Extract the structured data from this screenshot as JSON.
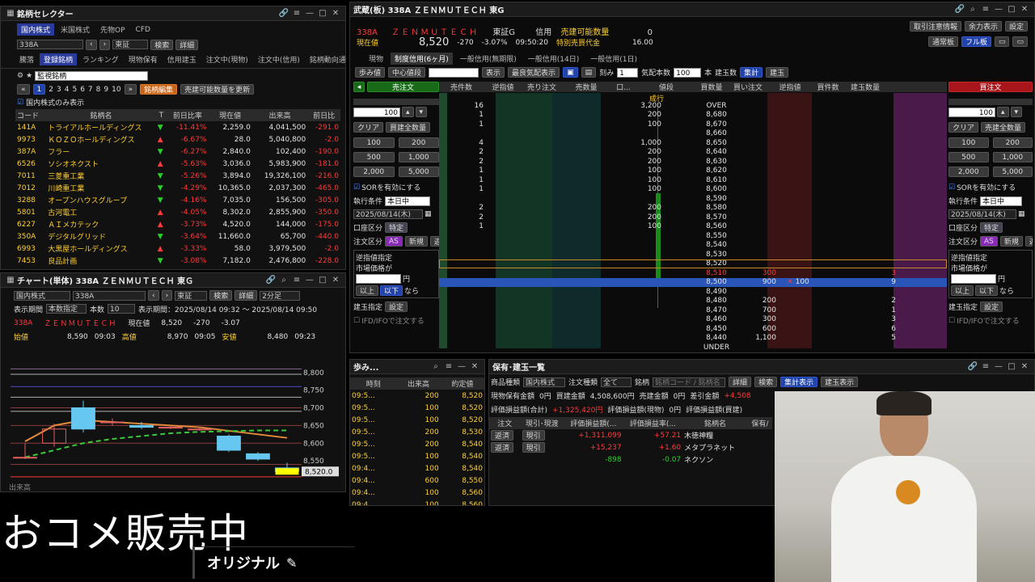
{
  "selector": {
    "title": "銘柄セレクター",
    "tabs1": [
      "国内株式",
      "米国株式",
      "先物OP",
      "CFD"
    ],
    "code": "338A",
    "market": "東証",
    "search": "検索",
    "detail": "詳細",
    "tabs2": [
      "騰落",
      "登録銘柄",
      "ランキング",
      "現物保有",
      "信用建玉",
      "注文中(現物)",
      "注文中(信用)",
      "銘柄動向通知"
    ],
    "list_name": "監視銘柄",
    "pages": [
      "1",
      "2",
      "3",
      "4",
      "5",
      "6",
      "7",
      "8",
      "9",
      "10"
    ],
    "edit_btn": "銘柄編集",
    "refresh_btn": "売建可能数量を更新",
    "show_domestic": "国内株式のみ表示",
    "cols": [
      "コード",
      "銘柄名",
      "T",
      "前日比率",
      "現在値",
      "出来高",
      "前日比"
    ],
    "rows": [
      {
        "code": "141A",
        "name": "トライアルホールディングス",
        "t": "▼",
        "rate": "-11.41%",
        "price": "2,259.0",
        "vol": "4,041,500",
        "diff": "-291.0"
      },
      {
        "code": "9973",
        "name": "ＫＯＺＯホールディングス",
        "t": "▲",
        "rate": "-6.67%",
        "price": "28.0",
        "vol": "5,040,800",
        "diff": "-2.0"
      },
      {
        "code": "387A",
        "name": "フラー",
        "t": "▼",
        "rate": "-6.27%",
        "price": "2,840.0",
        "vol": "102,400",
        "diff": "-190.0"
      },
      {
        "code": "6526",
        "name": "ソシオネクスト",
        "t": "▲",
        "rate": "-5.63%",
        "price": "3,036.0",
        "vol": "5,983,900",
        "diff": "-181.0"
      },
      {
        "code": "7011",
        "name": "三菱重工業",
        "t": "▼",
        "rate": "-5.26%",
        "price": "3,894.0",
        "vol": "19,326,100",
        "diff": "-216.0"
      },
      {
        "code": "7012",
        "name": "川崎重工業",
        "t": "▼",
        "rate": "-4.29%",
        "price": "10,365.0",
        "vol": "2,037,300",
        "diff": "-465.0"
      },
      {
        "code": "3288",
        "name": "オープンハウスグループ",
        "t": "▼",
        "rate": "-4.16%",
        "price": "7,035.0",
        "vol": "156,500",
        "diff": "-305.0"
      },
      {
        "code": "5801",
        "name": "古河電工",
        "t": "▲",
        "rate": "-4.05%",
        "price": "8,302.0",
        "vol": "2,855,900",
        "diff": "-350.0"
      },
      {
        "code": "6227",
        "name": "ＡＩメカテック",
        "t": "▲",
        "rate": "-3.73%",
        "price": "4,520.0",
        "vol": "144,000",
        "diff": "-175.0"
      },
      {
        "code": "350A",
        "name": "デジタルグリッド",
        "t": "▼",
        "rate": "-3.64%",
        "price": "11,660.0",
        "vol": "65,700",
        "diff": "-440.0"
      },
      {
        "code": "6993",
        "name": "大黒屋ホールディングス",
        "t": "▲",
        "rate": "-3.33%",
        "price": "58.0",
        "vol": "3,979,500",
        "diff": "-2.0"
      },
      {
        "code": "7453",
        "name": "良品計画",
        "t": "▼",
        "rate": "-3.08%",
        "price": "7,182.0",
        "vol": "2,476,800",
        "diff": "-228.0"
      }
    ]
  },
  "chart": {
    "title": "チャート(単体) 338A ＺＥＮＭＵＴＥＣＨ 東Ｇ",
    "market_sel": "国内株式",
    "code": "338A",
    "exch": "東証",
    "search": "検索",
    "detail": "詳細",
    "interval": "2分足",
    "period_label": "表示期間",
    "period_sel": "本数指定",
    "bars_label": "本数",
    "bars": "10",
    "range_label": "表示期間：2025/08/14 09:32 ～ 2025/08/14 09:50",
    "code_disp": "338A",
    "name_disp": "ＺＥＮＭＵＴＥＣＨ",
    "cur_label": "現在値",
    "cur": "8,520",
    "chg": "-270",
    "chg_pct": "-3.07",
    "open_label": "始値",
    "open": "8,590",
    "open_t": "09:03",
    "high_label": "高値",
    "high": "8,970",
    "high_t": "09:05",
    "low_label": "安値",
    "low": "8,480",
    "low_t": "09:23",
    "yticks": [
      "8,800",
      "8,750",
      "8,700",
      "8,650",
      "8,600",
      "8,550"
    ],
    "price_tag": "8,520.0",
    "bottom_label": "出来高"
  },
  "chart_data": {
    "type": "candlestick",
    "ylim": [
      8500,
      8820
    ],
    "candles": [
      {
        "o": 8560,
        "c": 8560,
        "h": 8600,
        "l": 8555
      },
      {
        "o": 8600,
        "c": 8640,
        "h": 8655,
        "l": 8590
      },
      {
        "o": 8700,
        "c": 8640,
        "h": 8720,
        "l": 8630
      },
      {
        "o": 8660,
        "c": 8660,
        "h": 8670,
        "l": 8650
      },
      {
        "o": 8650,
        "c": 8645,
        "h": 8660,
        "l": 8640
      },
      {
        "o": 8645,
        "c": 8645,
        "h": 8650,
        "l": 8640
      },
      {
        "o": 8640,
        "c": 8640,
        "h": 8645,
        "l": 8635
      },
      {
        "o": 8620,
        "c": 8580,
        "h": 8625,
        "l": 8575
      },
      {
        "o": 8570,
        "c": 8555,
        "h": 8575,
        "l": 8550
      },
      {
        "o": 8530,
        "c": 8520,
        "h": 8545,
        "l": 8520
      }
    ],
    "ma_short": [
      8605,
      8650,
      8665,
      8660,
      8655,
      8650,
      8645,
      8635,
      8625,
      8615
    ],
    "ma_long": [
      8560,
      8580,
      8600,
      8612,
      8620,
      8628,
      8632,
      8634,
      8636,
      8636
    ]
  },
  "board": {
    "title": "武蔵(板) 338A ＺＥＮＭＵＴＥＣＨ 東G",
    "top_btns": [
      "取引注意情報",
      "余力表示",
      "設定"
    ],
    "mode_btns": [
      "通常板",
      "フル板"
    ],
    "code": "338A",
    "name": "ＺＥＮＭＵＴＥＣＨ",
    "market": "東証G",
    "margin": "信用",
    "sellable_label": "売建可能数量",
    "sellable": "0",
    "cur_label": "現在値",
    "cur": "8,520",
    "chg": "-270",
    "chg_pct": "-3.07%",
    "time": "09:50:20",
    "special_label": "特別売買代金",
    "special": "16.00",
    "tabs": [
      "現物",
      "制度信用(6ヶ月)",
      "一般信用(無期限)",
      "一般信用(14日)",
      "一般信用(1日)"
    ],
    "toolbar": {
      "walk": "歩み値",
      "center": "中心値段",
      "display": "表示",
      "recent": "最良気配表示",
      "ticks": "刻み",
      "ticks_val": "1",
      "qty": "気配本数",
      "qty_val": "100",
      "unit": "本",
      "pos": "建玉数",
      "agg": "集計",
      "pos2": "建玉"
    },
    "sell_order": "売注文",
    "buy_order": "買注文",
    "cols": [
      "売件数",
      "逆指値",
      "売り注文",
      "売数量",
      "口...",
      "値段",
      "買数量",
      "買い注文",
      "逆指値",
      "買件数",
      "建玉数量"
    ],
    "rows": [
      {
        "sc": "16",
        "sq": "3,200",
        "p": "OVER",
        "bq": "",
        "bc": ""
      },
      {
        "sc": "1",
        "sq": "200",
        "p": "8,680",
        "bq": "",
        "bc": ""
      },
      {
        "sc": "1",
        "sq": "100",
        "p": "8,670",
        "bq": "",
        "bc": ""
      },
      {
        "sc": "",
        "sq": "",
        "p": "8,660",
        "bq": "",
        "bc": ""
      },
      {
        "sc": "4",
        "sq": "1,000",
        "p": "8,650",
        "bq": "",
        "bc": ""
      },
      {
        "sc": "2",
        "sq": "200",
        "p": "8,640",
        "bq": "",
        "bc": ""
      },
      {
        "sc": "2",
        "sq": "200",
        "p": "8,630",
        "bq": "",
        "bc": ""
      },
      {
        "sc": "1",
        "sq": "100",
        "p": "8,620",
        "bq": "",
        "bc": ""
      },
      {
        "sc": "1",
        "sq": "100",
        "p": "8,610",
        "bq": "",
        "bc": ""
      },
      {
        "sc": "1",
        "sq": "100",
        "p": "8,600",
        "bq": "",
        "bc": ""
      },
      {
        "sc": "",
        "sq": "",
        "p": "8,590",
        "bq": "",
        "bc": ""
      },
      {
        "sc": "2",
        "sq": "200",
        "p": "8,580",
        "bq": "",
        "bc": ""
      },
      {
        "sc": "2",
        "sq": "200",
        "p": "8,570",
        "bq": "",
        "bc": ""
      },
      {
        "sc": "1",
        "sq": "100",
        "p": "8,560",
        "bq": "",
        "bc": ""
      },
      {
        "sc": "",
        "sq": "",
        "p": "8,550",
        "bq": "",
        "bc": ""
      },
      {
        "sc": "",
        "sq": "",
        "p": "8,540",
        "bq": "",
        "bc": ""
      },
      {
        "sc": "",
        "sq": "",
        "p": "8,530",
        "bq": "",
        "bc": ""
      },
      {
        "sc": "",
        "sq": "",
        "p": "8,520",
        "bq": "",
        "bc": ""
      },
      {
        "sc": "",
        "sq": "",
        "p": "8,510",
        "bq": "300",
        "bc": "3"
      },
      {
        "sc": "",
        "sq": "",
        "p": "8,500",
        "bq": "900",
        "bc": "9",
        "mine": "100"
      },
      {
        "sc": "",
        "sq": "",
        "p": "8,490",
        "bq": "",
        "bc": ""
      },
      {
        "sc": "",
        "sq": "",
        "p": "8,480",
        "bq": "200",
        "bc": "2"
      },
      {
        "sc": "",
        "sq": "",
        "p": "8,470",
        "bq": "700",
        "bc": "1"
      },
      {
        "sc": "",
        "sq": "",
        "p": "8,460",
        "bq": "300",
        "bc": "3"
      },
      {
        "sc": "",
        "sq": "",
        "p": "8,450",
        "bq": "600",
        "bc": "6"
      },
      {
        "sc": "",
        "sq": "",
        "p": "8,440",
        "bq": "1,100",
        "bc": "5"
      },
      {
        "sc": "",
        "sq": "",
        "p": "UNDER",
        "bq": "",
        "bc": ""
      }
    ],
    "market_label": "成行",
    "panel": {
      "qty": "100",
      "clear": "クリア",
      "all_sell": "買建全数量",
      "all_buy": "売建全数量",
      "q": [
        "100",
        "200",
        "500",
        "1,000",
        "2,000",
        "5,000"
      ],
      "sor": "SORを有効にする",
      "cond_label": "執行条件",
      "cond": "本日中",
      "date": "2025/08/14(木)",
      "acct_label": "口座区分",
      "acct": "特定",
      "note_label": "注文区分",
      "as": "AS",
      "new": "新規",
      "close": "返済",
      "stop_label": "逆指値指定",
      "mkt": "市場価格が",
      "yen": "円",
      "above": "以上",
      "below": "以下",
      "nara": "なら",
      "pos_label": "建玉指定",
      "set": "設定",
      "ifd": "IFD/IFOで注文する"
    }
  },
  "walk": {
    "title": "歩み...",
    "cols": [
      "時刻",
      "出来高",
      "約定値"
    ],
    "rows": [
      {
        "t": "09:5...",
        "v": "200",
        "p": "8,520"
      },
      {
        "t": "09:5...",
        "v": "100",
        "p": "8,520"
      },
      {
        "t": "09:5...",
        "v": "100",
        "p": "8,520"
      },
      {
        "t": "09:5...",
        "v": "200",
        "p": "8,530"
      },
      {
        "t": "09:5...",
        "v": "200",
        "p": "8,540"
      },
      {
        "t": "09:5...",
        "v": "100",
        "p": "8,540"
      },
      {
        "t": "09:4...",
        "v": "100",
        "p": "8,540"
      },
      {
        "t": "09:4...",
        "v": "600",
        "p": "8,550"
      },
      {
        "t": "09:4...",
        "v": "100",
        "p": "8,560"
      },
      {
        "t": "09:4...",
        "v": "100",
        "p": "8,560"
      }
    ]
  },
  "holdings": {
    "title": "保有･建玉一覧",
    "type_label": "商品種類",
    "type": "国内株式",
    "order_type_label": "注文種類",
    "order_type": "全て",
    "brand_label": "銘柄",
    "brand_ph": "銘柄コード / 銘柄名",
    "detail": "詳細",
    "search": "検索",
    "agg": "集計表示",
    "pos": "建玉表示",
    "s1": "現物保有金額",
    "s1v": "0円",
    "s2": "買建金額",
    "s2v": "4,508,600円",
    "s3": "売建金額",
    "s3v": "0円",
    "s4": "差引金額",
    "s4v": "+4,508",
    "s5": "評価損益額(合計)",
    "s5v": "+1,325,420円",
    "s6": "評価損益額(現物)",
    "s6v": "0円",
    "s7": "評価損益額(買建)",
    "cols": [
      "注文",
      "現引･現渡",
      "評価損益額(...",
      "評価損益率(...",
      "銘柄名",
      "保有/"
    ],
    "rows": [
      {
        "o": "返済",
        "g": "現引",
        "pl": "+1,311,099",
        "pr": "+57.21",
        "name": "木徳神糧"
      },
      {
        "o": "返済",
        "g": "現引",
        "pl": "+15,237",
        "pr": "+1.60",
        "name": "メタプラネット"
      },
      {
        "o": "",
        "g": "",
        "pl": "-898",
        "pr": "-0.07",
        "name": "ネクソン"
      }
    ]
  },
  "overlay": {
    "main": "おコメ販売中",
    "sub": "オリジナル"
  },
  "colors": {
    "sell": "#2ad12a",
    "buy": "#ff3a3a",
    "tab_on": "#2a3a9a",
    "accent": "#c86418"
  }
}
